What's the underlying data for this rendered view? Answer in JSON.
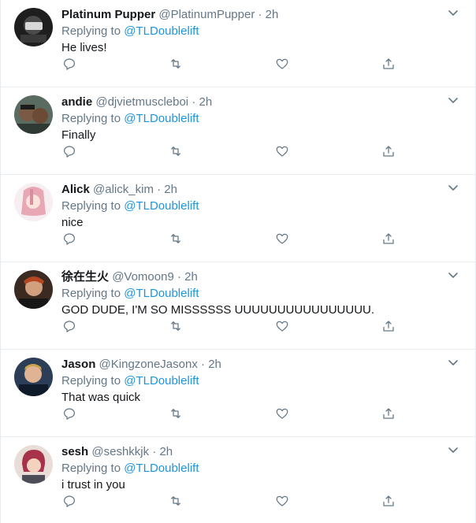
{
  "icons": {
    "reply": "reply-icon",
    "retweet": "retweet-icon",
    "like": "heart-icon",
    "share": "share-icon",
    "more": "chevron-down-icon"
  },
  "colors": {
    "link": "#1b95e0",
    "secondary": "#657786",
    "text": "#14171a",
    "divider": "#e6ecf0"
  },
  "tweets": [
    {
      "name": "Platinum Pupper",
      "handle": "@PlatinumPupper",
      "time": "2h",
      "replying_to": "Replying to",
      "mention": "@TLDoublelift",
      "text": "He lives!"
    },
    {
      "name": "andie",
      "handle": "@djvietmuscleboi",
      "time": "2h",
      "replying_to": "Replying to",
      "mention": "@TLDoublelift",
      "text": "Finally"
    },
    {
      "name": "Alick",
      "handle": "@alick_kim",
      "time": "2h",
      "replying_to": "Replying to",
      "mention": "@TLDoublelift",
      "text": "nice"
    },
    {
      "name": "徐在生火",
      "handle": "@Vomoon9",
      "time": "2h",
      "replying_to": "Replying to",
      "mention": "@TLDoublelift",
      "text": "GOD DUDE, I'M SO MISSSSSS UUUUUUUUUUUUUUUU."
    },
    {
      "name": "Jason",
      "handle": "@KingzoneJasonx",
      "time": "2h",
      "replying_to": "Replying to",
      "mention": "@TLDoublelift",
      "text": "That was quick"
    },
    {
      "name": "sesh",
      "handle": "@seshkkjk",
      "time": "2h",
      "replying_to": "Replying to",
      "mention": "@TLDoublelift",
      "text": "i trust in you"
    }
  ]
}
